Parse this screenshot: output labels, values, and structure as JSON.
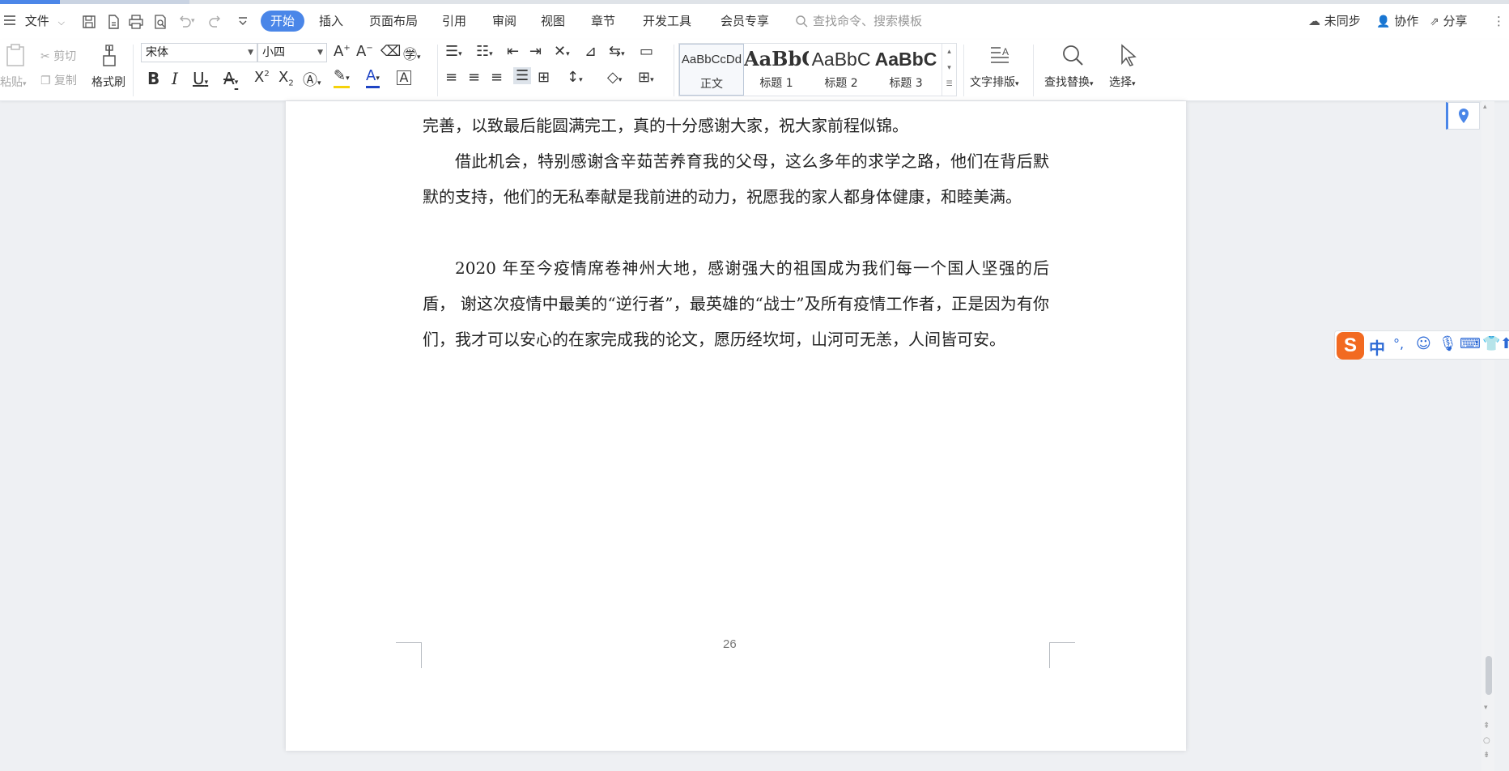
{
  "menubar": {
    "file_label": "文件",
    "tabs": [
      "开始",
      "插入",
      "页面布局",
      "引用",
      "审阅",
      "视图",
      "章节",
      "开发工具",
      "会员专享"
    ],
    "search_placeholder": "查找命令、搜索模板",
    "sync_label": "未同步",
    "collab_label": "协作",
    "share_label": "分享"
  },
  "ribbon": {
    "paste": "粘贴",
    "cut": "剪切",
    "copy": "复制",
    "format_painter": "格式刷",
    "font_name": "宋体",
    "font_size": "小四",
    "styles": [
      {
        "preview": "AaBbCcDd",
        "name": "正文"
      },
      {
        "preview": "AaBbC",
        "name": "标题 1"
      },
      {
        "preview": "AaBbC",
        "name": "标题 2"
      },
      {
        "preview": "AaBbC",
        "name": "标题 3"
      }
    ],
    "text_layout": "文字排版",
    "find_replace": "查找替换",
    "select": "选择"
  },
  "document": {
    "paragraphs": [
      "完善，以致最后能圆满完工，真的十分感谢大家，祝大家前程似锦。",
      "借此机会，特别感谢含辛茹苦养育我的父母，这么多年的求学之路，他们在背后默默的支持，他们的无私奉献是我前进的动力，祝愿我的家人都身体健康，和睦美满。",
      "2020 年至今疫情席卷神州大地，感谢强大的祖国成为我们每一个国人坚强的后盾，  谢这次疫情中最美的“逆行者”，最英雄的“战士”及所有疫情工作者，正是因为有你们，我才可以安心的在家完成我的论文，愿历经坎坷，山河可无恙，人间皆可安。"
    ],
    "page_number": "26"
  },
  "ime": {
    "logo": "S",
    "mode": "中"
  },
  "colors": {
    "accent": "#4a86e8",
    "ime_logo": "#f26a21"
  }
}
